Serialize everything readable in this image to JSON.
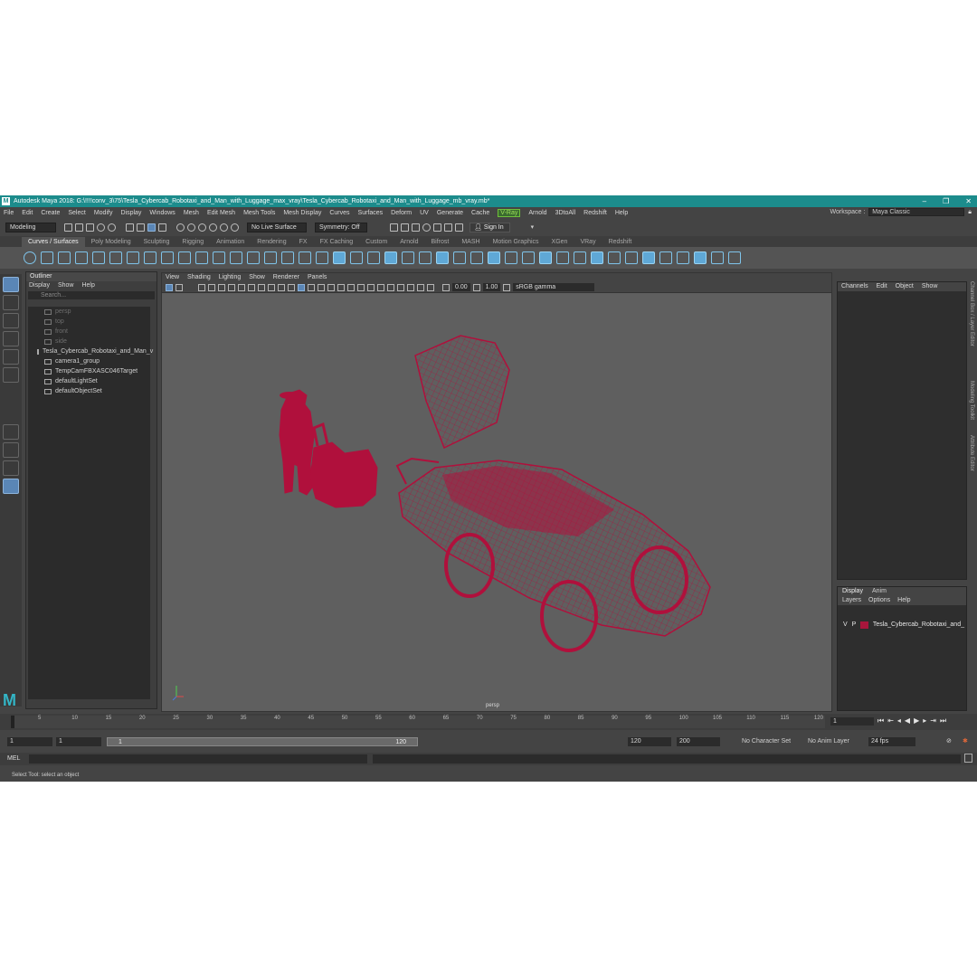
{
  "window": {
    "title": "Autodesk Maya 2018: G:\\!!!!conv_3\\75\\Tesla_Cybercab_Robotaxi_and_Man_with_Luggage_max_vray\\Tesla_Cybercab_Robotaxi_and_Man_with_Luggage_mb_vray.mb*",
    "logo": "M"
  },
  "menubar": [
    "File",
    "Edit",
    "Create",
    "Select",
    "Modify",
    "Display",
    "Windows",
    "Mesh",
    "Edit Mesh",
    "Mesh Tools",
    "Mesh Display",
    "Curves",
    "Surfaces",
    "Deform",
    "UV",
    "Generate",
    "Cache",
    "V-Ray",
    "Arnold",
    "3DtoAll",
    "Redshift",
    "Help"
  ],
  "workspace": {
    "label": "Workspace :",
    "value": "Maya Classic"
  },
  "statusline": {
    "mode": "Modeling",
    "live_surface": "No Live Surface",
    "symmetry": "Symmetry: Off",
    "sign_in": "Sign In"
  },
  "shelf_tabs": [
    "Curves / Surfaces",
    "Poly Modeling",
    "Sculpting",
    "Rigging",
    "Animation",
    "Rendering",
    "FX",
    "FX Caching",
    "Custom",
    "Arnold",
    "Bifrost",
    "MASH",
    "Motion Graphics",
    "XGen",
    "VRay",
    "Redshift"
  ],
  "outliner": {
    "title": "Outliner",
    "menu": [
      "Display",
      "Show",
      "Help"
    ],
    "search_placeholder": "Search...",
    "items": [
      {
        "name": "persp",
        "dim": true
      },
      {
        "name": "top",
        "dim": true
      },
      {
        "name": "front",
        "dim": true
      },
      {
        "name": "side",
        "dim": true
      },
      {
        "name": "Tesla_Cybercab_Robotaxi_and_Man_v",
        "dim": false
      },
      {
        "name": "camera1_group",
        "dim": false
      },
      {
        "name": "TempCamFBXASC046Target",
        "dim": false
      },
      {
        "name": "defaultLightSet",
        "dim": false
      },
      {
        "name": "defaultObjectSet",
        "dim": false
      }
    ]
  },
  "viewport": {
    "menu": [
      "View",
      "Shading",
      "Lighting",
      "Show",
      "Renderer",
      "Panels"
    ],
    "exposure": "0.00",
    "gamma": "1.00",
    "color_space": "sRGB gamma",
    "camera": "persp",
    "wire_color": "#b0103c"
  },
  "channel_box": {
    "menu": [
      "Channels",
      "Edit",
      "Object",
      "Show"
    ]
  },
  "side_tabs": [
    "Channel Box / Layer Editor",
    "Modeling Toolkit",
    "Attribute Editor"
  ],
  "layer_editor": {
    "tabs": [
      "Display",
      "Anim"
    ],
    "menu": [
      "Layers",
      "Options",
      "Help"
    ],
    "layer": {
      "v": "V",
      "p": "P",
      "name": "Tesla_Cybercab_Robotaxi_and_",
      "color": "#a8163c"
    }
  },
  "timeslider": {
    "ticks": [
      "5",
      "10",
      "15",
      "20",
      "25",
      "30",
      "35",
      "40",
      "45",
      "50",
      "55",
      "60",
      "65",
      "70",
      "75",
      "80",
      "85",
      "90",
      "95",
      "100",
      "105",
      "110",
      "115",
      "120"
    ],
    "current_frame": "1",
    "frame_field": "1"
  },
  "range": {
    "start": "1",
    "start2": "1",
    "slider_start": "1",
    "slider_end": "120",
    "end": "120",
    "end2": "200",
    "character_set": "No Character Set",
    "anim_layer": "No Anim Layer",
    "fps": "24 fps"
  },
  "cmdline": {
    "label": "MEL"
  },
  "helpline": {
    "text": "Select Tool: select an object"
  }
}
